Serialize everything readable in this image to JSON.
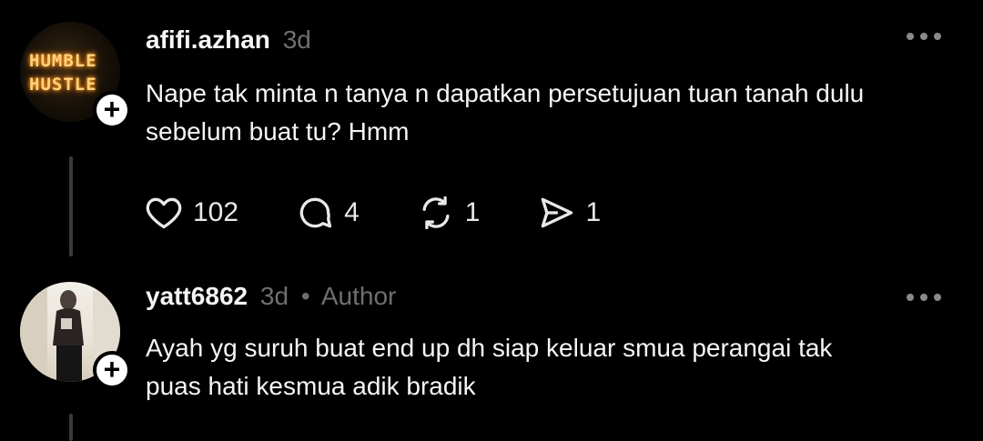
{
  "posts": [
    {
      "username": "afifi.azhan",
      "time": "3d",
      "author_tag": "",
      "avatar_text": [
        "HUMBLE",
        "HUSTLE"
      ],
      "body_lines": [
        "Nape tak minta n tanya n dapatkan persetujuan tuan tanah dulu",
        "sebelum buat tu? Hmm"
      ],
      "stats": {
        "likes": "102",
        "comments": "4",
        "reposts": "1",
        "shares": "1"
      }
    },
    {
      "username": "yatt6862",
      "time": "3d",
      "separator": "•",
      "author_tag": "Author",
      "body_lines": [
        "Ayah yg suruh buat end up dh siap keluar smua perangai tak",
        "puas hati kesmua adik bradik"
      ]
    }
  ],
  "icons": {
    "like": "heart-icon",
    "comment": "comment-icon",
    "repost": "repost-icon",
    "share": "share-icon",
    "follow": "plus-icon",
    "more": "more-icon"
  },
  "colors": {
    "background": "#000000",
    "text": "#f3f5f7",
    "muted": "#6f6f6f"
  }
}
